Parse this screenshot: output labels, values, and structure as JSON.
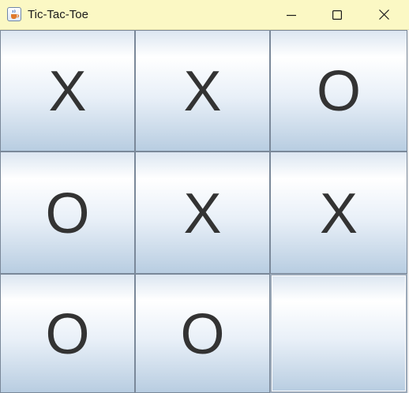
{
  "window": {
    "title": "Tic-Tac-Toe",
    "app_icon": "java-coffee-cup-icon",
    "controls": {
      "minimize_icon": "minimize-icon",
      "maximize_icon": "maximize-icon",
      "close_icon": "close-icon"
    }
  },
  "board": {
    "cells": [
      "X",
      "X",
      "O",
      "O",
      "X",
      "X",
      "O",
      "O",
      ""
    ]
  },
  "colors": {
    "titlebar": "#fbf8c4",
    "mark_text": "#333333",
    "cell_gradient_top": "#dce6f1",
    "cell_gradient_bottom": "#b8cde1",
    "cell_border": "#7a8899"
  }
}
